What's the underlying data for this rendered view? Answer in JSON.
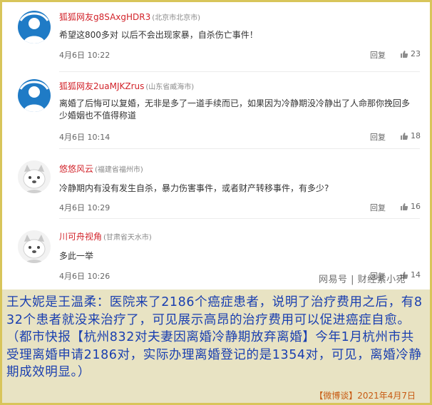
{
  "comments": [
    {
      "username": "狐狐网友g8SAxgHDR3",
      "location": "(北京市北京市)",
      "text": "希望这800多对 以后不会出现家暴，自杀伤亡事件！",
      "time": "4月6日 10:22",
      "reply": "回复",
      "likes": "23",
      "avatar": "default-avatar-blue"
    },
    {
      "username": "狐狐网友2uaMJKZrus",
      "location": "(山东省威海市)",
      "text": "离婚了后悔可以复婚，无非是多了一道手续而已，如果因为冷静期没冷静出了人命那你挽回多少婚姻也不值得称道",
      "time": "4月6日 10:14",
      "reply": "回复",
      "likes": "18",
      "avatar": "default-avatar-blue"
    },
    {
      "username": "悠悠风云",
      "location": "(福建省福州市)",
      "text": "冷静期内有没有发生自杀，暴力伤害事件，或者财产转移事件，有多少?",
      "time": "4月6日 10:29",
      "reply": "回复",
      "likes": "16",
      "avatar": "dog-avatar"
    },
    {
      "username": "川可舟视角",
      "location": "(甘肃省天水市)",
      "text": "多此一举",
      "time": "4月6日 10:26",
      "reply": "回复",
      "likes": "14",
      "avatar": "dog-avatar"
    }
  ],
  "watermark": "网易号 | 财经紫小宛",
  "caption": "王大妮是王温柔：医院来了2186个癌症患者，说明了治疗费用之后，有832个患者就没来治疗了，可见展示高昂的治疗费用可以促进癌症自愈。（都市快报【杭州832对夫妻因离婚冷静期放弃离婚】今年1月杭州市共受理离婚申请2186对，实际办理离婚登记的是1354对，可见，离婚冷静期成效明显。）",
  "footer": "【微博谈】2021年4月7日",
  "colors": {
    "username": "#d2232a",
    "caption_text": "#1a3fb0",
    "caption_bg": "#e8e3c3",
    "footer_text": "#c75a12",
    "border": "#d8c55a"
  }
}
